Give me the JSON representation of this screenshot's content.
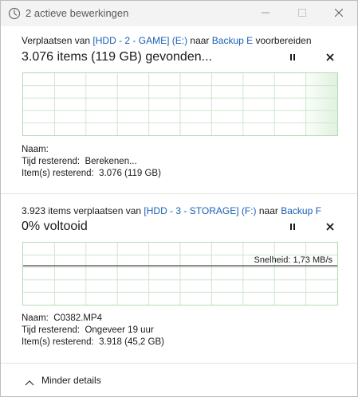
{
  "window": {
    "title": "2 actieve bewerkingen",
    "icons": {
      "app": "clock-icon",
      "minimize": "minimize-icon",
      "maximize": "maximize-icon",
      "close": "close-icon"
    }
  },
  "operations": [
    {
      "line": {
        "prefix": "Verplaatsen van ",
        "source": "[HDD - 2 - GAME] (E:)",
        "middle": " naar ",
        "destination": "Backup E",
        "suffix": " voorbereiden"
      },
      "status": "3.076 items (119 GB) gevonden...",
      "speed": "",
      "progress": 0,
      "details": {
        "name_label": "Naam:",
        "name_value": "",
        "time_label": "Tijd resterend:",
        "time_value": "Berekenen...",
        "items_label": "Item(s) resterend:",
        "items_value": "3.076 (119 GB)"
      }
    },
    {
      "line": {
        "prefix": "3.923 items verplaatsen van ",
        "source": "[HDD - 3 - STORAGE] (F:)",
        "middle": " naar ",
        "destination": "Backup F",
        "suffix": ""
      },
      "status": "0% voltooid",
      "speed": "Snelheid: 1,73 MB/s",
      "progress": 0,
      "details": {
        "name_label": "Naam:",
        "name_value": "C0382.MP4",
        "time_label": "Tijd resterend:",
        "time_value": "Ongeveer 19 uur",
        "items_label": "Item(s) resterend:",
        "items_value": "3.918 (45,2 GB)"
      }
    }
  ],
  "footer": {
    "label": "Minder details",
    "icon": "chevron-up-icon"
  },
  "colors": {
    "graph_grid": "#b7d8b7",
    "graph_fill": "#dff2df",
    "link": "#1a5fb4",
    "titlebar": "#f3f3f3"
  }
}
